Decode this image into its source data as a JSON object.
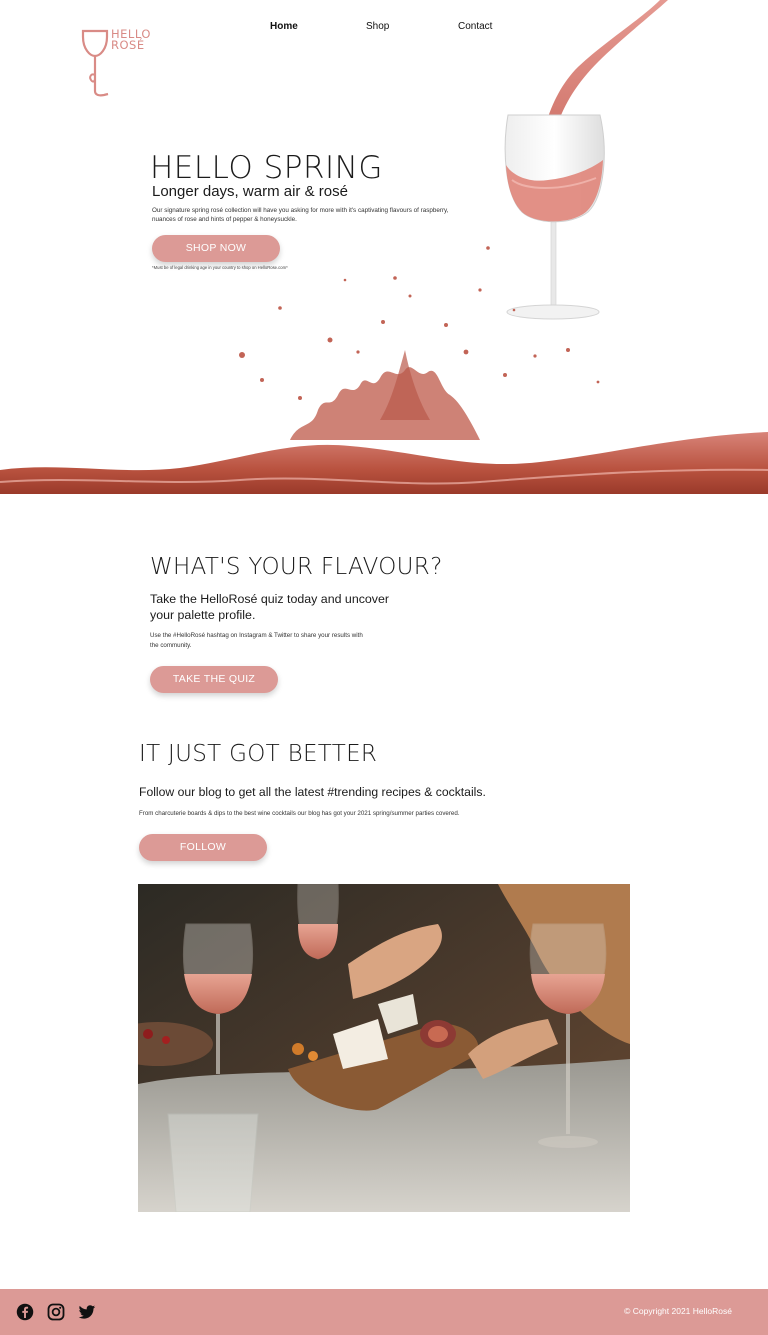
{
  "header": {
    "logo_line1": "HELLO",
    "logo_line2": "ROSÉ",
    "nav": {
      "home": "Home",
      "shop": "Shop",
      "contact": "Contact"
    }
  },
  "hero": {
    "title": "HELLO SPRING",
    "subtitle": "Longer days, warm air & rosé",
    "body": "Our signature spring rosé collection will have you asking for more with it's captivating flavours of raspberry, nuances of rose and hints of pepper & honeysuckle.",
    "button": "SHOP NOW",
    "note": "*Must be of legal drinking age in your country to shop on HelloRose.com*"
  },
  "quiz": {
    "title": "WHAT'S YOUR FLAVOUR?",
    "subtitle": "Take the HelloRosé quiz today and uncover your palette profile.",
    "body": "Use the #HelloRosé hashtag on Instagram & Twitter to share your results with the community.",
    "button": "TAKE THE QUIZ"
  },
  "blog": {
    "title": "IT JUST GOT BETTER",
    "subtitle": "Follow our blog to get all the latest #trending recipes & cocktails.",
    "body": "From charcuterie boards & dips to the best wine cocktails our blog has got your 2021 spring/summer parties covered.",
    "button": "FOLLOW"
  },
  "footer": {
    "icons": [
      "facebook-icon",
      "instagram-icon",
      "twitter-icon"
    ],
    "copyright": "© Copyright 2021 HelloRosé"
  },
  "colors": {
    "accent": "#dc9a96",
    "rose_liquid": "#c96a5e",
    "logo": "#d98b86"
  }
}
